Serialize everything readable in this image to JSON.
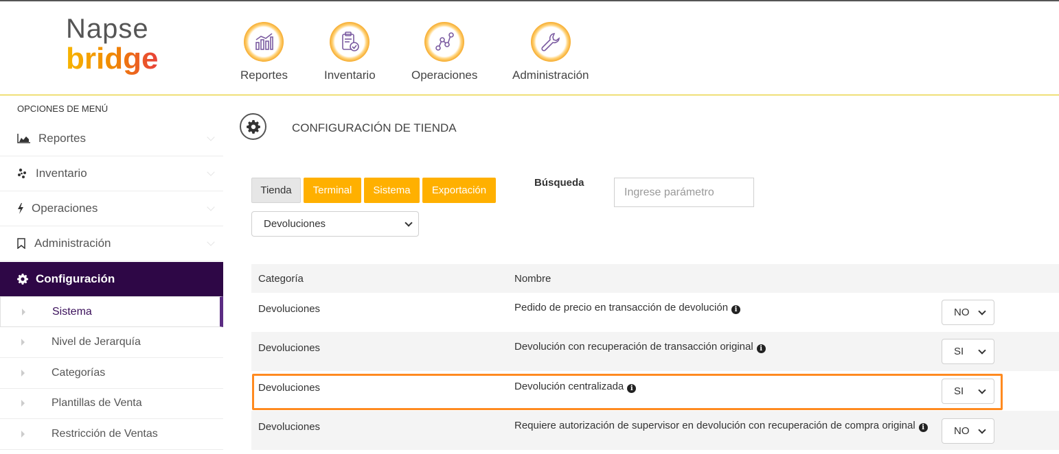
{
  "app": {
    "logo_line1": "Napse",
    "logo_line2": "bridge"
  },
  "topnav": [
    {
      "label": "Reportes",
      "icon": "chart-icon"
    },
    {
      "label": "Inventario",
      "icon": "clipboard-check-icon"
    },
    {
      "label": "Operaciones",
      "icon": "nodes-icon"
    },
    {
      "label": "Administración",
      "icon": "wrench-icon"
    }
  ],
  "sidebar": {
    "title": "OPCIONES DE MENÚ",
    "items": [
      {
        "label": "Reportes",
        "icon": "area-chart-icon"
      },
      {
        "label": "Inventario",
        "icon": "yelp-icon"
      },
      {
        "label": "Operaciones",
        "icon": "bolt-icon"
      },
      {
        "label": "Administración",
        "icon": "bookmark-icon"
      },
      {
        "label": "Configuración",
        "icon": "gear-icon"
      }
    ],
    "subitems": [
      {
        "label": "Sistema"
      },
      {
        "label": "Nivel de Jerarquía"
      },
      {
        "label": "Categorías"
      },
      {
        "label": "Plantillas de Venta"
      },
      {
        "label": "Restricción de Ventas"
      }
    ]
  },
  "page": {
    "title": "CONFIGURACIÓN DE TIENDA"
  },
  "tabs": [
    {
      "label": "Tienda"
    },
    {
      "label": "Terminal"
    },
    {
      "label": "Sistema"
    },
    {
      "label": "Exportación"
    }
  ],
  "category_select": {
    "value": "Devoluciones"
  },
  "search": {
    "label": "Búsqueda",
    "placeholder": "Ingrese parámetro"
  },
  "table": {
    "headers": {
      "category": "Categoría",
      "name": "Nombre"
    },
    "rows": [
      {
        "category": "Devoluciones",
        "name": "Pedido de precio en transacción de devolución",
        "value": "NO"
      },
      {
        "category": "Devoluciones",
        "name": "Devolución con recuperación de transacción original",
        "value": "SI"
      },
      {
        "category": "Devoluciones",
        "name": "Devolución centralizada",
        "value": "SI"
      },
      {
        "category": "Devoluciones",
        "name": "Requiere autorización de supervisor en devolución con recuperación de compra original",
        "value": "NO"
      }
    ]
  },
  "colors": {
    "accent": "#ffb000",
    "sidebar_active": "#2e0746",
    "highlight": "#ff8a1f"
  }
}
